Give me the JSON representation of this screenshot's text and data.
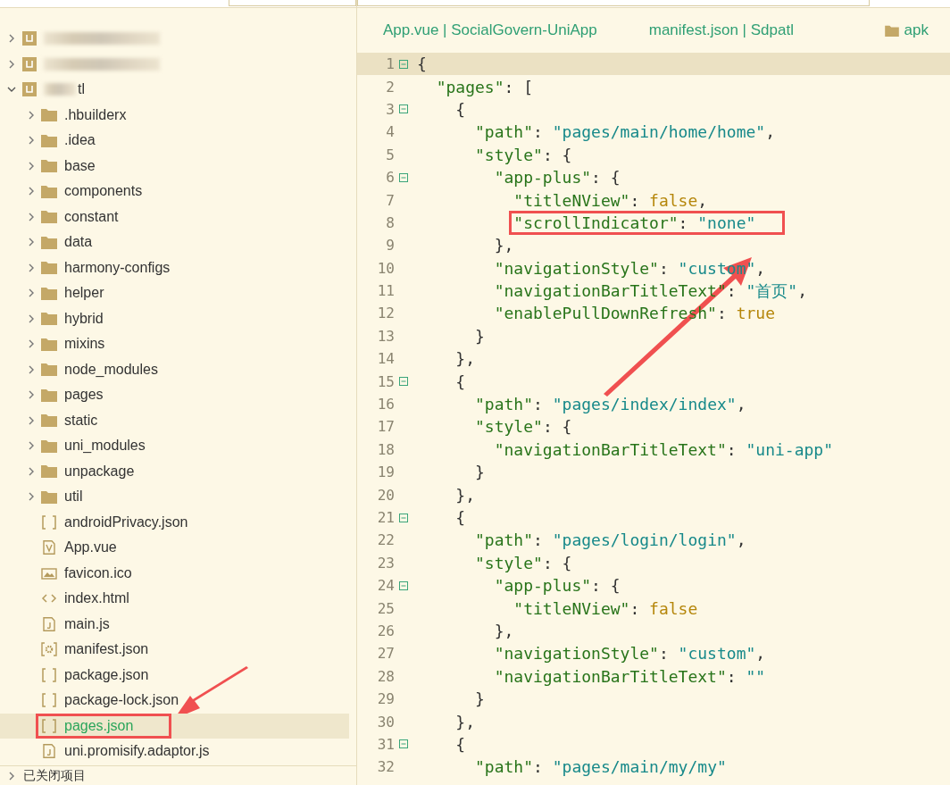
{
  "sidebar": {
    "projects": [
      {
        "redacted": true,
        "expanded": false
      },
      {
        "redacted": true,
        "expanded": false
      },
      {
        "redacted": true,
        "name": "tl",
        "expanded": true,
        "children": [
          {
            "label": ".hbuilderx",
            "kind": "folder",
            "expanded": false,
            "selected": false,
            "boxed": false
          },
          {
            "label": ".idea",
            "kind": "folder",
            "expanded": false,
            "selected": false,
            "boxed": false
          },
          {
            "label": "base",
            "kind": "folder",
            "expanded": false,
            "selected": false,
            "boxed": false
          },
          {
            "label": "components",
            "kind": "folder",
            "expanded": false,
            "selected": false,
            "boxed": false
          },
          {
            "label": "constant",
            "kind": "folder",
            "expanded": false,
            "selected": false,
            "boxed": false
          },
          {
            "label": "data",
            "kind": "folder",
            "expanded": false,
            "selected": false,
            "boxed": false
          },
          {
            "label": "harmony-configs",
            "kind": "folder",
            "expanded": false,
            "selected": false,
            "boxed": false
          },
          {
            "label": "helper",
            "kind": "folder",
            "expanded": false,
            "selected": false,
            "boxed": false
          },
          {
            "label": "hybrid",
            "kind": "folder",
            "expanded": false,
            "selected": false,
            "boxed": false
          },
          {
            "label": "mixins",
            "kind": "folder",
            "expanded": false,
            "selected": false,
            "boxed": false
          },
          {
            "label": "node_modules",
            "kind": "folder",
            "expanded": false,
            "selected": false,
            "boxed": false
          },
          {
            "label": "pages",
            "kind": "folder",
            "expanded": false,
            "selected": false,
            "boxed": false
          },
          {
            "label": "static",
            "kind": "folder",
            "expanded": false,
            "selected": false,
            "boxed": false
          },
          {
            "label": "uni_modules",
            "kind": "folder",
            "expanded": false,
            "selected": false,
            "boxed": false
          },
          {
            "label": "unpackage",
            "kind": "folder",
            "expanded": false,
            "selected": false,
            "boxed": false
          },
          {
            "label": "util",
            "kind": "folder",
            "expanded": false,
            "selected": false,
            "boxed": false
          },
          {
            "label": "androidPrivacy.json",
            "kind": "json",
            "selected": false,
            "boxed": false
          },
          {
            "label": "App.vue",
            "kind": "vue",
            "selected": false,
            "boxed": false
          },
          {
            "label": "favicon.ico",
            "kind": "image",
            "selected": false,
            "boxed": false
          },
          {
            "label": "index.html",
            "kind": "html",
            "selected": false,
            "boxed": false
          },
          {
            "label": "main.js",
            "kind": "js",
            "selected": false,
            "boxed": false
          },
          {
            "label": "manifest.json",
            "kind": "config",
            "selected": false,
            "boxed": false
          },
          {
            "label": "package.json",
            "kind": "json",
            "selected": false,
            "boxed": false
          },
          {
            "label": "package-lock.json",
            "kind": "json",
            "selected": false,
            "boxed": false
          },
          {
            "label": "pages.json",
            "kind": "json",
            "selected": true,
            "boxed": true
          },
          {
            "label": "uni.promisify.adaptor.js",
            "kind": "js",
            "selected": false,
            "boxed": false
          }
        ]
      }
    ],
    "closed_projects": {
      "label": "已关闭项目",
      "expanded": false
    }
  },
  "tabs": [
    {
      "label": "App.vue | SocialGovern-UniApp",
      "kind": "file"
    },
    {
      "label": "manifest.json | Sdpatl",
      "kind": "file"
    },
    {
      "label": "apk",
      "kind": "folder"
    }
  ],
  "editor": {
    "lines": [
      {
        "number": "1",
        "fold": true,
        "current": true,
        "boxed": false,
        "tokens": [
          {
            "kind": "p",
            "text": "{"
          }
        ]
      },
      {
        "number": "2",
        "fold": false,
        "current": false,
        "boxed": false,
        "tokens": [
          {
            "kind": "k",
            "text": "  \"pages\""
          },
          {
            "kind": "p",
            "text": ": ["
          }
        ]
      },
      {
        "number": "3",
        "fold": true,
        "current": false,
        "boxed": false,
        "tokens": [
          {
            "kind": "p",
            "text": "    {"
          }
        ]
      },
      {
        "number": "4",
        "fold": false,
        "current": false,
        "boxed": false,
        "tokens": [
          {
            "kind": "k",
            "text": "      \"path\""
          },
          {
            "kind": "p",
            "text": ": "
          },
          {
            "kind": "s",
            "text": "\"pages/main/home/home\""
          },
          {
            "kind": "p",
            "text": ","
          }
        ]
      },
      {
        "number": "5",
        "fold": false,
        "current": false,
        "boxed": false,
        "tokens": [
          {
            "kind": "k",
            "text": "      \"style\""
          },
          {
            "kind": "p",
            "text": ": {"
          }
        ]
      },
      {
        "number": "6",
        "fold": true,
        "current": false,
        "boxed": false,
        "tokens": [
          {
            "kind": "k",
            "text": "        \"app-plus\""
          },
          {
            "kind": "p",
            "text": ": {"
          }
        ]
      },
      {
        "number": "7",
        "fold": false,
        "current": false,
        "boxed": false,
        "tokens": [
          {
            "kind": "k",
            "text": "          \"titleNView\""
          },
          {
            "kind": "p",
            "text": ": "
          },
          {
            "kind": "b",
            "text": "false"
          },
          {
            "kind": "p",
            "text": ","
          }
        ]
      },
      {
        "number": "8",
        "fold": false,
        "current": false,
        "boxed": true,
        "tokens": [
          {
            "kind": "k",
            "text": "          \"scrollIndicator\""
          },
          {
            "kind": "p",
            "text": ": "
          },
          {
            "kind": "s",
            "text": "\"none\""
          }
        ]
      },
      {
        "number": "9",
        "fold": false,
        "current": false,
        "boxed": false,
        "tokens": [
          {
            "kind": "p",
            "text": "        },"
          }
        ]
      },
      {
        "number": "10",
        "fold": false,
        "current": false,
        "boxed": false,
        "tokens": [
          {
            "kind": "k",
            "text": "        \"navigationStyle\""
          },
          {
            "kind": "p",
            "text": ": "
          },
          {
            "kind": "s",
            "text": "\"custom\""
          },
          {
            "kind": "p",
            "text": ","
          }
        ]
      },
      {
        "number": "11",
        "fold": false,
        "current": false,
        "boxed": false,
        "tokens": [
          {
            "kind": "k",
            "text": "        \"navigationBarTitleText\""
          },
          {
            "kind": "p",
            "text": ": "
          },
          {
            "kind": "s",
            "text": "\"首页\""
          },
          {
            "kind": "p",
            "text": ","
          }
        ]
      },
      {
        "number": "12",
        "fold": false,
        "current": false,
        "boxed": false,
        "tokens": [
          {
            "kind": "k",
            "text": "        \"enablePullDownRefresh\""
          },
          {
            "kind": "p",
            "text": ": "
          },
          {
            "kind": "b",
            "text": "true"
          }
        ]
      },
      {
        "number": "13",
        "fold": false,
        "current": false,
        "boxed": false,
        "tokens": [
          {
            "kind": "p",
            "text": "      }"
          }
        ]
      },
      {
        "number": "14",
        "fold": false,
        "current": false,
        "boxed": false,
        "tokens": [
          {
            "kind": "p",
            "text": "    },"
          }
        ]
      },
      {
        "number": "15",
        "fold": true,
        "current": false,
        "boxed": false,
        "tokens": [
          {
            "kind": "p",
            "text": "    {"
          }
        ]
      },
      {
        "number": "16",
        "fold": false,
        "current": false,
        "boxed": false,
        "tokens": [
          {
            "kind": "k",
            "text": "      \"path\""
          },
          {
            "kind": "p",
            "text": ": "
          },
          {
            "kind": "s",
            "text": "\"pages/index/index\""
          },
          {
            "kind": "p",
            "text": ","
          }
        ]
      },
      {
        "number": "17",
        "fold": false,
        "current": false,
        "boxed": false,
        "tokens": [
          {
            "kind": "k",
            "text": "      \"style\""
          },
          {
            "kind": "p",
            "text": ": {"
          }
        ]
      },
      {
        "number": "18",
        "fold": false,
        "current": false,
        "boxed": false,
        "tokens": [
          {
            "kind": "k",
            "text": "        \"navigationBarTitleText\""
          },
          {
            "kind": "p",
            "text": ": "
          },
          {
            "kind": "s",
            "text": "\"uni-app\""
          }
        ]
      },
      {
        "number": "19",
        "fold": false,
        "current": false,
        "boxed": false,
        "tokens": [
          {
            "kind": "p",
            "text": "      }"
          }
        ]
      },
      {
        "number": "20",
        "fold": false,
        "current": false,
        "boxed": false,
        "tokens": [
          {
            "kind": "p",
            "text": "    },"
          }
        ]
      },
      {
        "number": "21",
        "fold": true,
        "current": false,
        "boxed": false,
        "tokens": [
          {
            "kind": "p",
            "text": "    {"
          }
        ]
      },
      {
        "number": "22",
        "fold": false,
        "current": false,
        "boxed": false,
        "tokens": [
          {
            "kind": "k",
            "text": "      \"path\""
          },
          {
            "kind": "p",
            "text": ": "
          },
          {
            "kind": "s",
            "text": "\"pages/login/login\""
          },
          {
            "kind": "p",
            "text": ","
          }
        ]
      },
      {
        "number": "23",
        "fold": false,
        "current": false,
        "boxed": false,
        "tokens": [
          {
            "kind": "k",
            "text": "      \"style\""
          },
          {
            "kind": "p",
            "text": ": {"
          }
        ]
      },
      {
        "number": "24",
        "fold": true,
        "current": false,
        "boxed": false,
        "tokens": [
          {
            "kind": "k",
            "text": "        \"app-plus\""
          },
          {
            "kind": "p",
            "text": ": {"
          }
        ]
      },
      {
        "number": "25",
        "fold": false,
        "current": false,
        "boxed": false,
        "tokens": [
          {
            "kind": "k",
            "text": "          \"titleNView\""
          },
          {
            "kind": "p",
            "text": ": "
          },
          {
            "kind": "b",
            "text": "false"
          }
        ]
      },
      {
        "number": "26",
        "fold": false,
        "current": false,
        "boxed": false,
        "tokens": [
          {
            "kind": "p",
            "text": "        },"
          }
        ]
      },
      {
        "number": "27",
        "fold": false,
        "current": false,
        "boxed": false,
        "tokens": [
          {
            "kind": "k",
            "text": "        \"navigationStyle\""
          },
          {
            "kind": "p",
            "text": ": "
          },
          {
            "kind": "s",
            "text": "\"custom\""
          },
          {
            "kind": "p",
            "text": ","
          }
        ]
      },
      {
        "number": "28",
        "fold": false,
        "current": false,
        "boxed": false,
        "tokens": [
          {
            "kind": "k",
            "text": "        \"navigationBarTitleText\""
          },
          {
            "kind": "p",
            "text": ": "
          },
          {
            "kind": "s",
            "text": "\"\""
          }
        ]
      },
      {
        "number": "29",
        "fold": false,
        "current": false,
        "boxed": false,
        "tokens": [
          {
            "kind": "p",
            "text": "      }"
          }
        ]
      },
      {
        "number": "30",
        "fold": false,
        "current": false,
        "boxed": false,
        "tokens": [
          {
            "kind": "p",
            "text": "    },"
          }
        ]
      },
      {
        "number": "31",
        "fold": true,
        "current": false,
        "boxed": false,
        "tokens": [
          {
            "kind": "p",
            "text": "    {"
          }
        ]
      },
      {
        "number": "32",
        "fold": false,
        "current": false,
        "boxed": false,
        "tokens": [
          {
            "kind": "k",
            "text": "      \"path\""
          },
          {
            "kind": "p",
            "text": ": "
          },
          {
            "kind": "s",
            "text": "\"pages/main/my/my\""
          }
        ]
      }
    ]
  }
}
